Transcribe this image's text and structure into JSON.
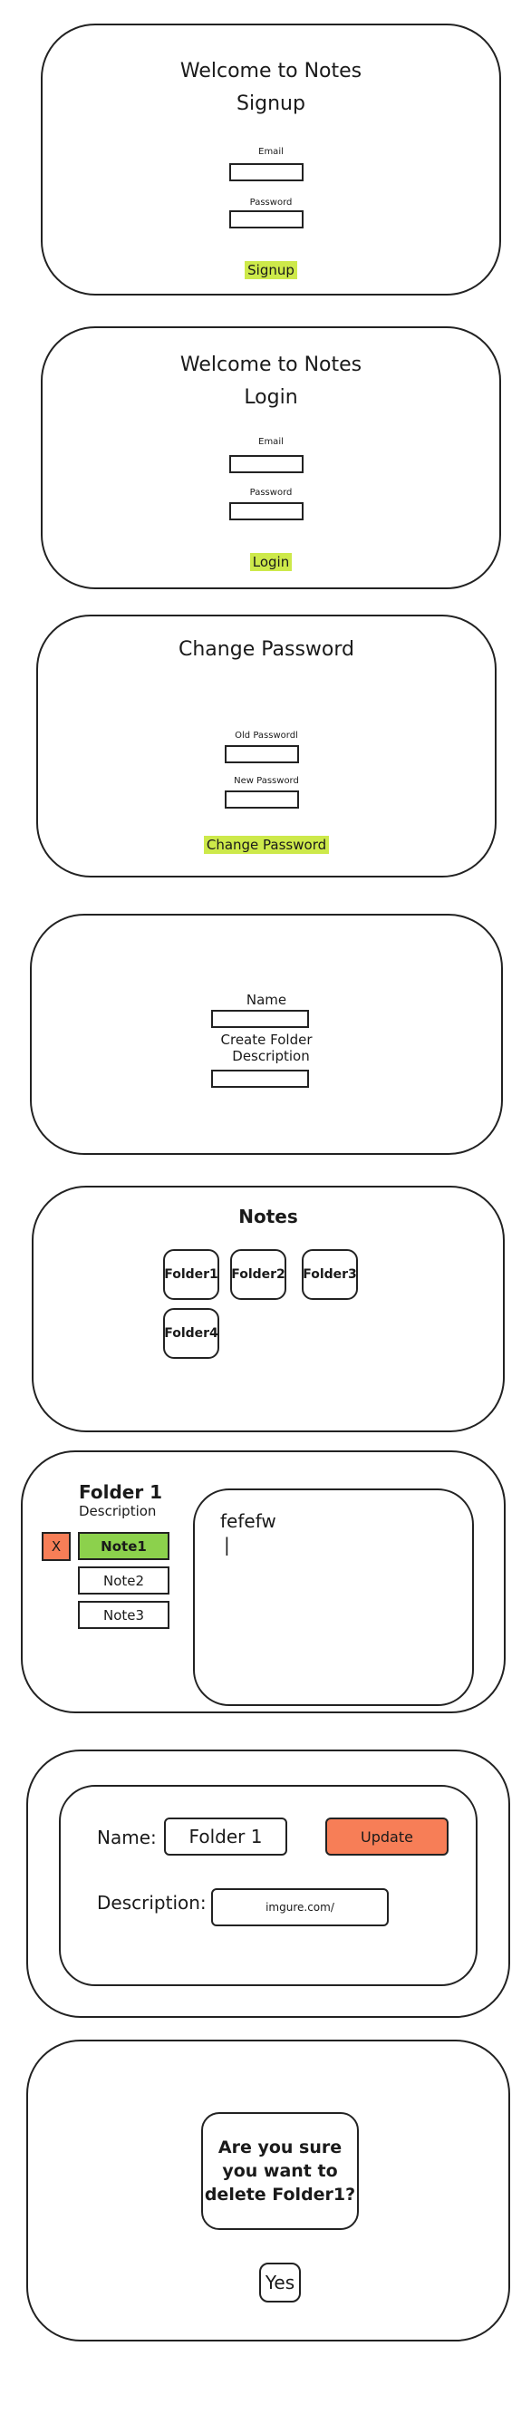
{
  "signup": {
    "welcome": "Welcome to Notes",
    "heading": "Signup",
    "email_label": "Email",
    "password_label": "Password",
    "submit_label": "Signup"
  },
  "login": {
    "welcome": "Welcome to Notes",
    "heading": "Login",
    "email_label": "Email",
    "password_label": "Password",
    "submit_label": "Login"
  },
  "change_password": {
    "heading": "Change Password",
    "old_label": "Old Passwordl",
    "new_label": "New Password",
    "submit_label": "Change Password"
  },
  "create_folder": {
    "name_label": "Name",
    "create_label": "Create Folder",
    "description_label": "Description"
  },
  "notes_home": {
    "heading": "Notes",
    "folders": [
      "Folder1",
      "Folder2",
      "Folder3",
      "Folder4"
    ]
  },
  "folder_view": {
    "title": "Folder 1",
    "description": "Description",
    "delete_label": "X",
    "notes": [
      "Note1",
      "Note2",
      "Note3"
    ],
    "editor_text": "fefefw",
    "cursor": "|",
    "colors": {
      "active_note": "#8cd14c",
      "delete": "#f77e57"
    }
  },
  "edit_folder": {
    "name_label": "Name:",
    "name_value": "Folder 1",
    "update_label": "Update",
    "description_label": "Description:",
    "description_value": "imgure.com/",
    "colors": {
      "update": "#f77e57"
    }
  },
  "confirm_delete": {
    "question": "Are you sure you want to delete Folder1?",
    "line1": "Are you sure",
    "line2": "you want to",
    "line3": "delete Folder1?",
    "yes_label": "Yes"
  },
  "colors": {
    "highlight": "#cde94a"
  }
}
